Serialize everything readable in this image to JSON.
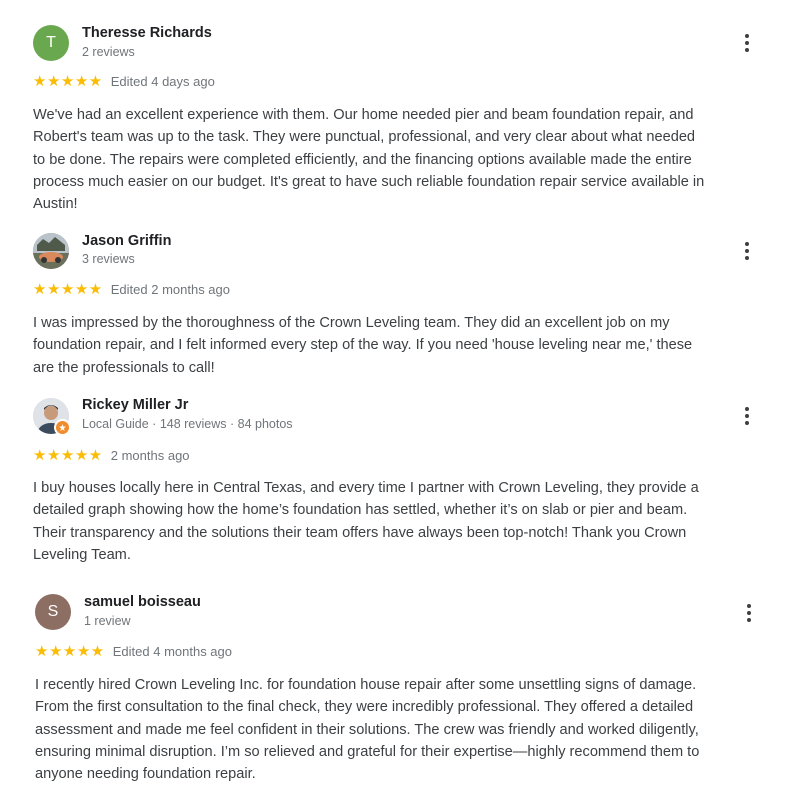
{
  "reviews": [
    {
      "avatar_letter": "T",
      "avatar_color": "#6aa84f",
      "name": "Theresse Richards",
      "meta": "2 reviews",
      "stars": "★★★★★",
      "date": "Edited 4 days ago",
      "lines": [
        "We've had an excellent experience with them. Our home needed pier and beam foundation repair, and",
        "Robert's team was up to the task. They were punctual, professional, and very clear about what needed",
        "to be done. The repairs were completed efficiently, and the financing options available made the entire",
        "process much easier on our budget. It's great to have such reliable foundation repair service available in",
        "Austin!"
      ]
    },
    {
      "avatar_letter": "",
      "avatar_color": "#8a8f7a",
      "name": "Jason Griffin",
      "meta": "3 reviews",
      "stars": "★★★★★",
      "date": "Edited 2 months ago",
      "lines": [
        "I was impressed by the thoroughness of the Crown Leveling team. They did an excellent job on my",
        "foundation repair, and I felt informed every step of the way. If you need 'house leveling near me,' these",
        "are the professionals to call!"
      ]
    },
    {
      "avatar_letter": "",
      "avatar_color": "#c9ccd1",
      "name": "Rickey Miller Jr",
      "meta": "Local Guide · 148 reviews · 84 photos",
      "stars": "★★★★★",
      "date": "2 months ago",
      "lines": [
        "I buy houses locally here in Central Texas, and every time I partner with Crown Leveling, they provide a",
        "detailed graph showing how the home’s foundation has settled, whether it’s on slab or pier and beam.",
        "Their transparency and the solutions their team offers have always been top-notch! Thank you Crown",
        "Leveling Team."
      ]
    },
    {
      "avatar_letter": "S",
      "avatar_color": "#8d6e63",
      "name": "samuel boisseau",
      "meta": "1 review",
      "stars": "★★★★★",
      "date": "Edited 4 months ago",
      "lines": [
        "I recently hired Crown Leveling Inc. for foundation house repair after some unsettling signs of damage.",
        "From the first consultation to the final check, they were incredibly professional. They offered a detailed",
        "assessment and made me feel confident in their solutions. The crew was friendly and worked diligently,",
        "ensuring minimal disruption. I’m so relieved and grateful for their expertise—highly recommend them to",
        "anyone needing foundation repair."
      ]
    }
  ]
}
